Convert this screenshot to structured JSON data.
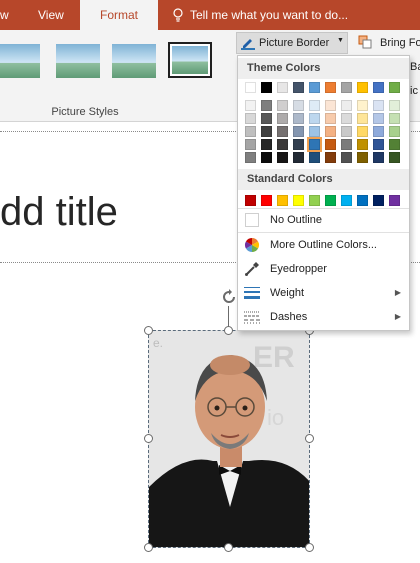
{
  "ribbon": {
    "tabs": [
      {
        "label": "w"
      },
      {
        "label": "View"
      },
      {
        "label": "Format"
      }
    ],
    "tell_me": "Tell me what you want to do...",
    "group_label": "Picture Styles",
    "picture_border_label": "Picture Border",
    "bring_forward_label": "Bring Fo",
    "partial_label_1": "Ba",
    "partial_label_2": "ic"
  },
  "slide": {
    "title_partial": "dd title"
  },
  "menu": {
    "theme_header": "Theme Colors",
    "standard_header": "Standard Colors",
    "theme_rows": [
      [
        "#ffffff",
        "#000000",
        "#e7e6e6",
        "#44546a",
        "#5b9bd5",
        "#ed7d31",
        "#a5a5a5",
        "#ffc000",
        "#4472c4",
        "#70ad47"
      ],
      [
        "#f2f2f2",
        "#7f7f7f",
        "#d0cece",
        "#d6dce4",
        "#deebf6",
        "#fbe5d5",
        "#ededed",
        "#fff2cc",
        "#dae3f3",
        "#e2efd9"
      ],
      [
        "#d8d8d8",
        "#595959",
        "#aeabab",
        "#adb9ca",
        "#bdd7ee",
        "#f7cbac",
        "#dbdbdb",
        "#fee599",
        "#b4c7e7",
        "#c5e0b3"
      ],
      [
        "#bfbfbf",
        "#3f3f3f",
        "#757070",
        "#8496b0",
        "#9dc3e6",
        "#f4b183",
        "#c9c9c9",
        "#ffd965",
        "#8eaadb",
        "#a8d08d"
      ],
      [
        "#a5a5a5",
        "#262626",
        "#3a3838",
        "#323f4f",
        "#2e75b5",
        "#c55a11",
        "#7b7b7b",
        "#bf9000",
        "#2f5496",
        "#538135"
      ],
      [
        "#7f7f7f",
        "#0c0c0c",
        "#171616",
        "#222a35",
        "#1f4e79",
        "#833c0b",
        "#525252",
        "#7f6000",
        "#1f3864",
        "#375623"
      ]
    ],
    "standard_colors": [
      "#c00000",
      "#ff0000",
      "#ffc000",
      "#ffff00",
      "#92d050",
      "#00b050",
      "#00b0f0",
      "#0070c0",
      "#002060",
      "#7030a0"
    ],
    "selected_swatch": "row 5, column 5",
    "items": [
      {
        "label": "No Outline",
        "icon": "no-outline-swatch"
      },
      {
        "label": "More Outline Colors...",
        "icon": "color-wheel-icon"
      },
      {
        "label": "Eyedropper",
        "icon": "eyedropper-icon"
      },
      {
        "label": "Weight",
        "icon": "weight-lines-icon"
      },
      {
        "label": "Dashes",
        "icon": "dashes-lines-icon"
      }
    ]
  }
}
